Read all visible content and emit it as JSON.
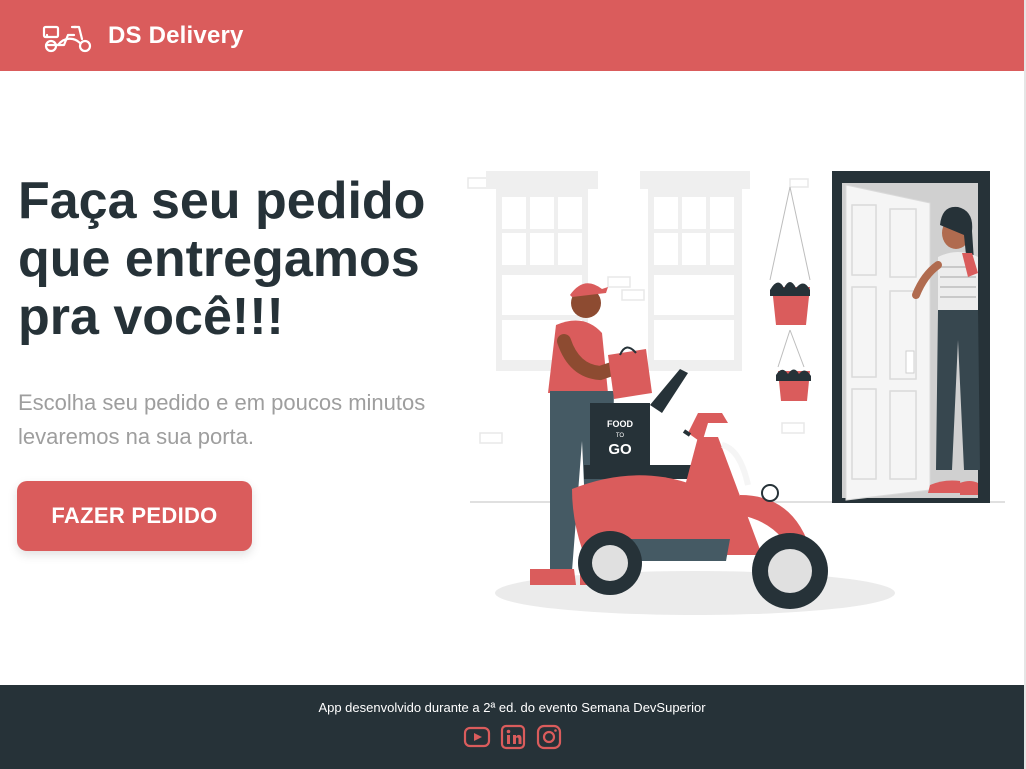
{
  "header": {
    "title": "DS Delivery",
    "logo_icon": "scooter-icon",
    "background": "#DA5C5C"
  },
  "hero": {
    "title": "Faça seu pedido que entregamos pra você!!!",
    "subtitle": "Escolha seu pedido e em poucos minutos levaremos na sua porta.",
    "cta_label": "FAZER PEDIDO",
    "illustration_icon": "delivery-scooter-illustration",
    "illustration_box_text": [
      "FOOD",
      "TO",
      "GO"
    ]
  },
  "footer": {
    "text": "App desenvolvido durante a 2ª ed. do evento Semana DevSuperior",
    "socials": [
      {
        "icon": "youtube-icon"
      },
      {
        "icon": "linkedin-icon"
      },
      {
        "icon": "instagram-icon"
      }
    ],
    "background": "#263238"
  },
  "colors": {
    "primary": "#DA5C5C",
    "dark": "#263238",
    "text_muted": "#9E9E9E"
  }
}
